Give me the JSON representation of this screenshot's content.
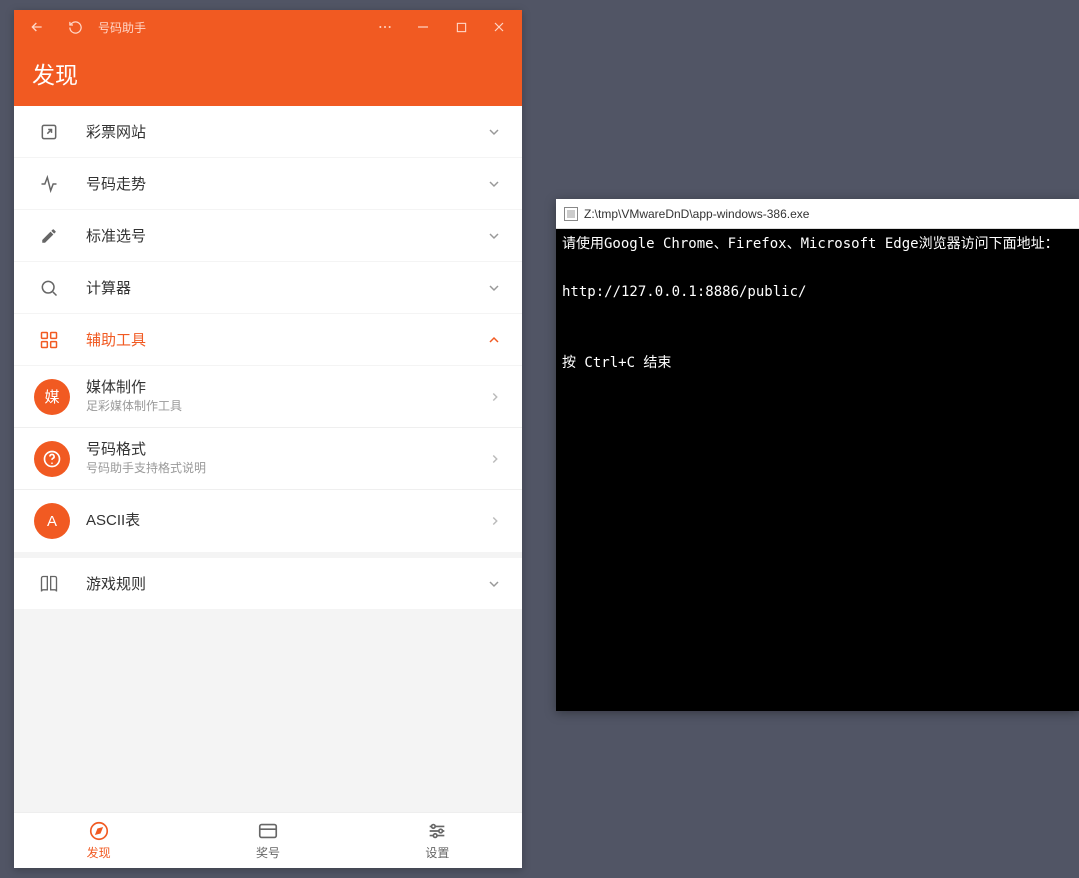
{
  "titlebar": {
    "title": "号码助手"
  },
  "header": {
    "title": "发现"
  },
  "menu": [
    {
      "id": "lottery",
      "label": "彩票网站"
    },
    {
      "id": "trend",
      "label": "号码走势"
    },
    {
      "id": "pick",
      "label": "标准选号"
    },
    {
      "id": "calc",
      "label": "计算器"
    },
    {
      "id": "tools",
      "label": "辅助工具",
      "active": true
    },
    {
      "id": "rules",
      "label": "游戏规则"
    }
  ],
  "tools_sub": [
    {
      "avatar": "媒",
      "title": "媒体制作",
      "subtitle": "足彩媒体制作工具"
    },
    {
      "avatar": "?",
      "title": "号码格式",
      "subtitle": "号码助手支持格式说明"
    },
    {
      "avatar": "A",
      "title": "ASCII表",
      "subtitle": ""
    }
  ],
  "tabs": [
    {
      "id": "discover",
      "label": "发现",
      "active": true
    },
    {
      "id": "prize",
      "label": "奖号"
    },
    {
      "id": "settings",
      "label": "设置"
    }
  ],
  "console": {
    "title": "Z:\\tmp\\VMwareDnD\\app-windows-386.exe",
    "line1": "请使用Google Chrome、Firefox、Microsoft Edge浏览器访问下面地址：",
    "line2": "http://127.0.0.1:8886/public/",
    "line3": "按 Ctrl+C 结束"
  }
}
